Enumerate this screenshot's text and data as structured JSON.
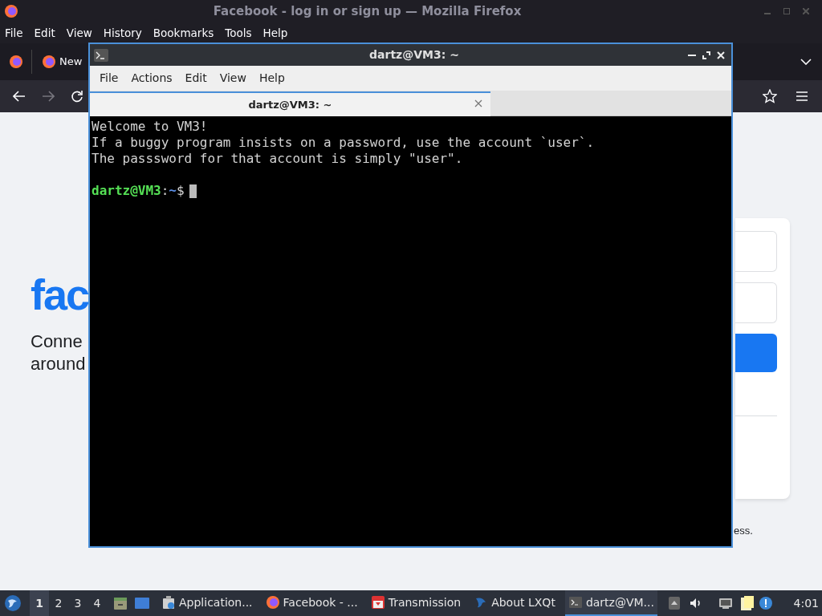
{
  "browser": {
    "title": "Facebook - log in or sign up — Mozilla Firefox",
    "menu": [
      "File",
      "Edit",
      "View",
      "History",
      "Bookmarks",
      "Tools",
      "Help"
    ],
    "tabs": [
      {
        "label": "New",
        "selected": false
      }
    ],
    "page": {
      "logo": "fac",
      "tagline_lines": [
        "Conne",
        "around"
      ],
      "footer_fragment": "ess."
    }
  },
  "terminal": {
    "title": "dartz@VM3: ~",
    "menu": [
      "File",
      "Actions",
      "Edit",
      "View",
      "Help"
    ],
    "tabs": [
      {
        "label": "dartz@VM3: ~",
        "selected": true
      }
    ],
    "lines": [
      "Welcome to VM3!",
      "If a buggy program insists on a password, use the account `user`.",
      "The passsword for that account is simply \"user\"."
    ],
    "prompt": {
      "user_host": "dartz@VM3",
      "separator": ":",
      "path": "~",
      "symbol": "$"
    }
  },
  "taskbar": {
    "workspaces": [
      {
        "label": "1",
        "selected": true
      },
      {
        "label": "2",
        "selected": false
      },
      {
        "label": "3",
        "selected": false
      },
      {
        "label": "4",
        "selected": false
      }
    ],
    "tasks": [
      {
        "label": "Application...",
        "selected": false
      },
      {
        "label": "Facebook - ...",
        "selected": false
      },
      {
        "label": "Transmission",
        "selected": false
      },
      {
        "label": "About LXQt",
        "selected": false
      },
      {
        "label": "dartz@VM...",
        "selected": true
      }
    ],
    "clock": "4:01"
  }
}
